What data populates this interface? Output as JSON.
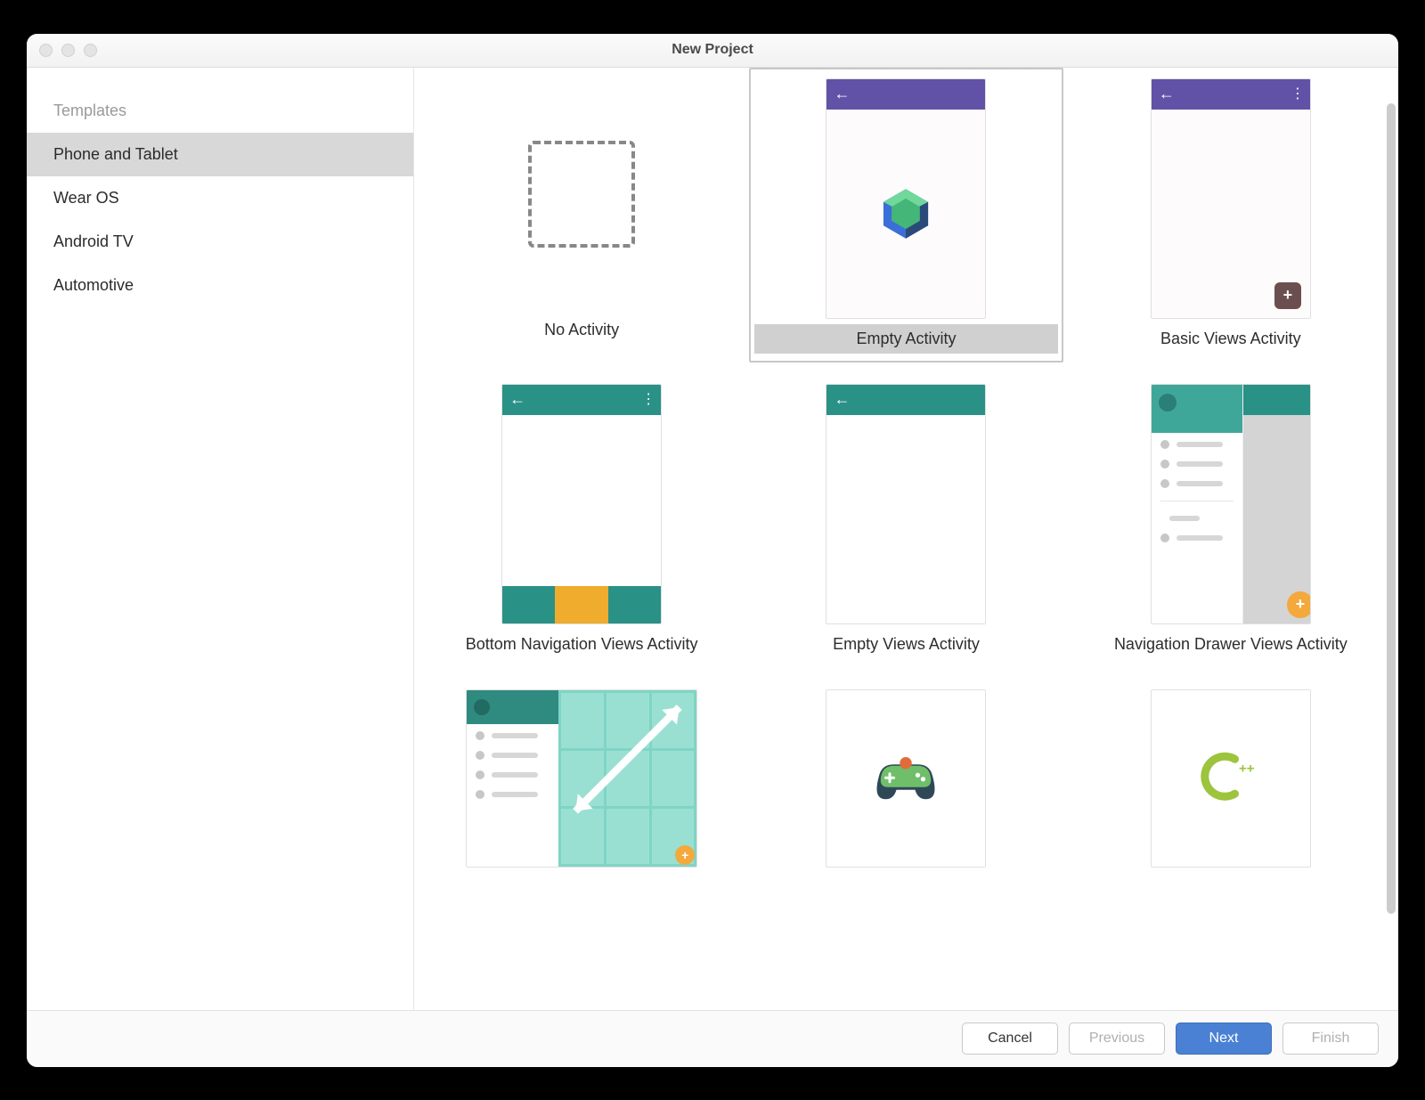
{
  "window": {
    "title": "New Project"
  },
  "sidebar": {
    "header": "Templates",
    "items": [
      "Phone and Tablet",
      "Wear OS",
      "Android TV",
      "Automotive"
    ],
    "selectedIndex": 0
  },
  "templates": [
    {
      "label": "No Activity",
      "kind": "none",
      "selected": false
    },
    {
      "label": "Empty Activity",
      "kind": "compose",
      "selected": true
    },
    {
      "label": "Basic Views Activity",
      "kind": "basic",
      "selected": false
    },
    {
      "label": "Bottom Navigation Views Activity",
      "kind": "bottomnav",
      "selected": false
    },
    {
      "label": "Empty Views Activity",
      "kind": "empty-teal",
      "selected": false
    },
    {
      "label": "Navigation Drawer Views Activity",
      "kind": "drawer",
      "selected": false
    },
    {
      "label": "",
      "kind": "responsive",
      "selected": false
    },
    {
      "label": "",
      "kind": "game",
      "selected": false
    },
    {
      "label": "",
      "kind": "cpp",
      "selected": false
    }
  ],
  "footer": {
    "cancel": "Cancel",
    "previous": "Previous",
    "next": "Next",
    "finish": "Finish"
  }
}
